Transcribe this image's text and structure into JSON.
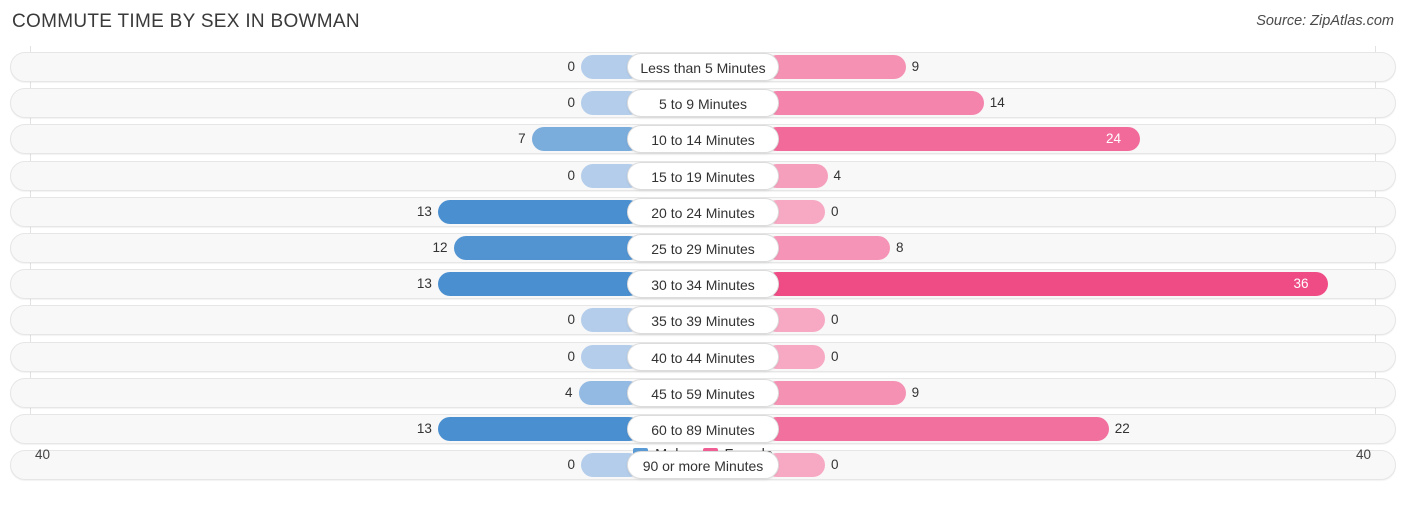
{
  "header": {
    "title": "COMMUTE TIME BY SEX IN BOWMAN",
    "source": "Source: ZipAtlas.com"
  },
  "legend": {
    "items": [
      {
        "label": "Male",
        "color": "#5b9bd5"
      },
      {
        "label": "Female",
        "color": "#ef5f93"
      }
    ]
  },
  "axis": {
    "left_label": "40",
    "right_label": "40",
    "max": 40
  },
  "chart_data": {
    "type": "bar",
    "title": "COMMUTE TIME BY SEX IN BOWMAN",
    "subtitle": "",
    "xlabel": "",
    "ylabel": "",
    "orientation": "horizontal-diverging",
    "axis_max": 40,
    "xlim": [
      40,
      40
    ],
    "grid": false,
    "legend_position": "bottom-center",
    "categories": [
      "Less than 5 Minutes",
      "5 to 9 Minutes",
      "10 to 14 Minutes",
      "15 to 19 Minutes",
      "20 to 24 Minutes",
      "25 to 29 Minutes",
      "30 to 34 Minutes",
      "35 to 39 Minutes",
      "40 to 44 Minutes",
      "45 to 59 Minutes",
      "60 to 89 Minutes",
      "90 or more Minutes"
    ],
    "series": [
      {
        "name": "Male",
        "color": "#5b9bd5",
        "values": [
          0,
          0,
          7,
          0,
          13,
          12,
          13,
          0,
          0,
          4,
          13,
          0
        ]
      },
      {
        "name": "Female",
        "color": "#ef5f93",
        "values": [
          9,
          14,
          24,
          4,
          0,
          8,
          36,
          0,
          0,
          9,
          22,
          0
        ]
      }
    ]
  }
}
